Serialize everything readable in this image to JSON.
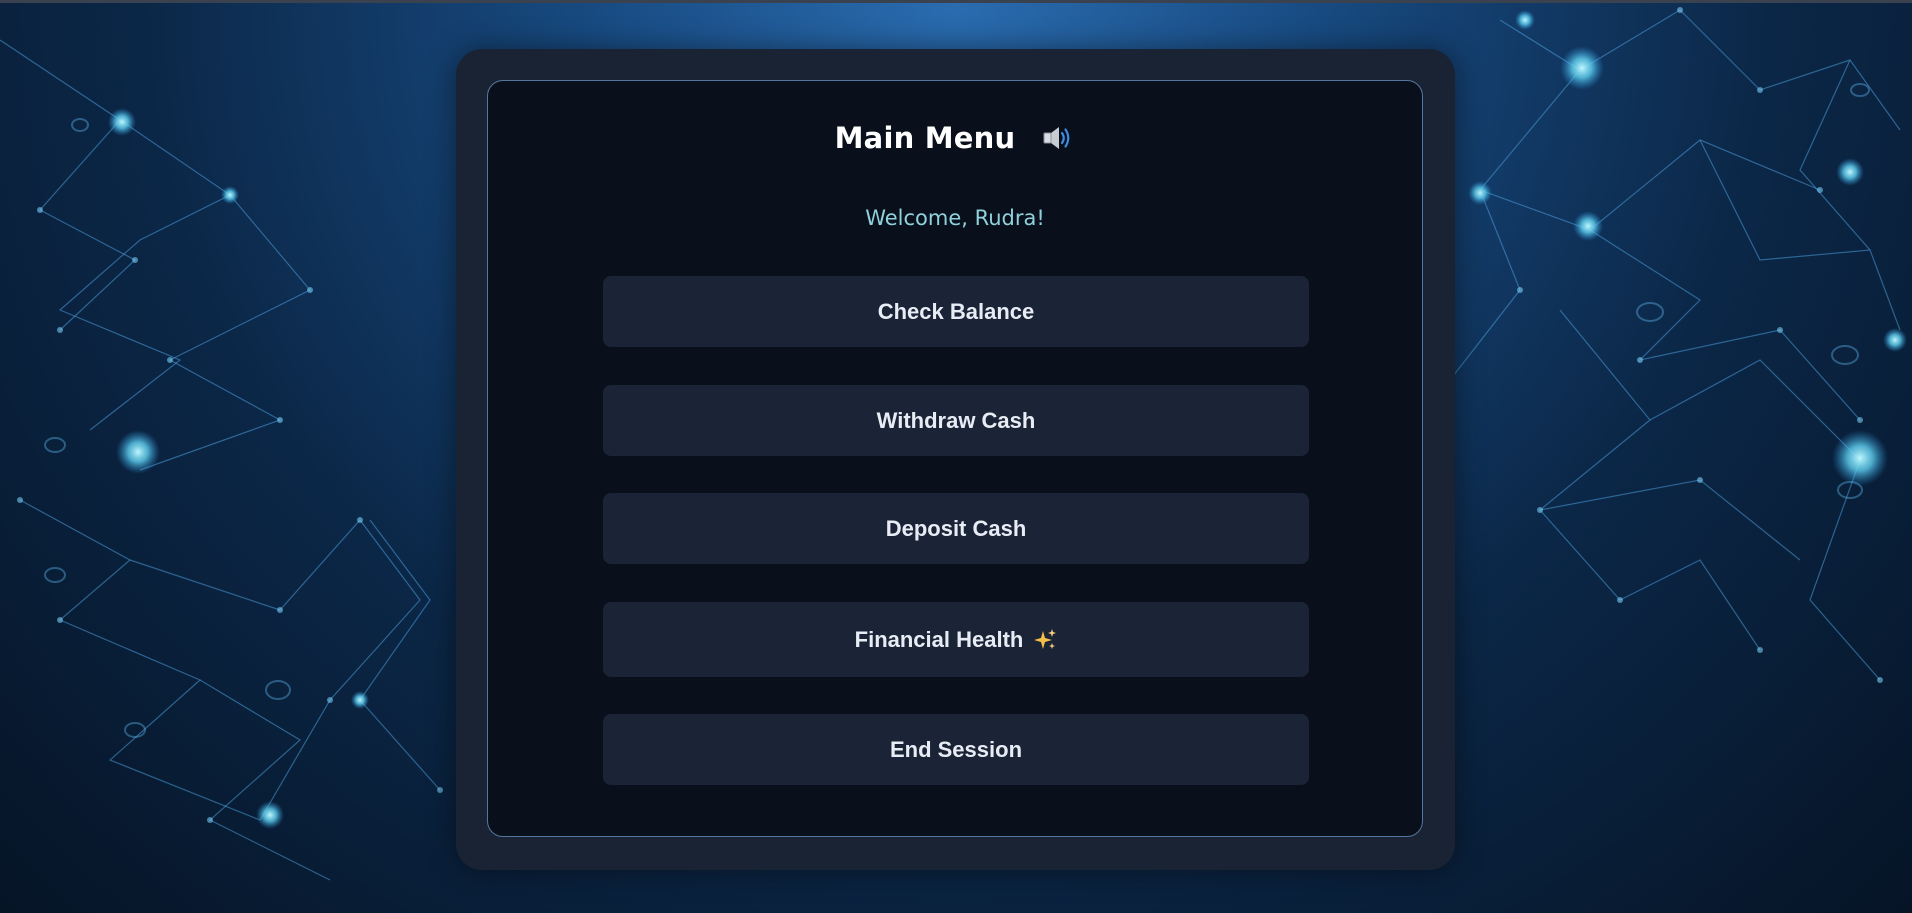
{
  "menu": {
    "title": "Main Menu",
    "sound_icon": "speaker-volume-icon",
    "welcome": "Welcome, Rudra!",
    "buttons": [
      {
        "label": "Check Balance"
      },
      {
        "label": "Withdraw Cash"
      },
      {
        "label": "Deposit Cash"
      },
      {
        "label": "Financial Health",
        "icon": "sparkles-icon"
      },
      {
        "label": "End Session"
      }
    ]
  },
  "colors": {
    "panel_background": "#0a101b",
    "frame_background": "#1a2334",
    "button_background": "#1b2436",
    "welcome_text": "#8fd1dc",
    "panel_border": "#5576a0"
  }
}
